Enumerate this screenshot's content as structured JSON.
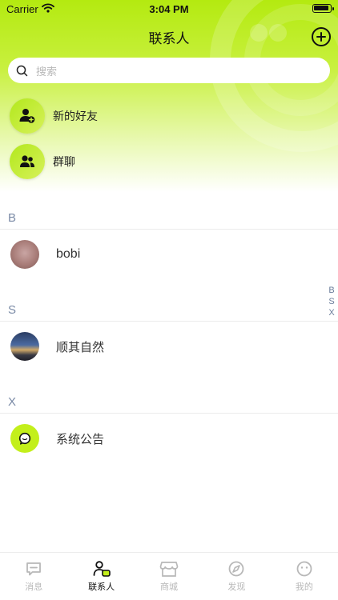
{
  "status_bar": {
    "carrier": "Carrier",
    "time": "3:04 PM"
  },
  "nav": {
    "title": "联系人",
    "add_icon": "plus-circle-icon"
  },
  "search": {
    "placeholder": "搜索"
  },
  "entries": [
    {
      "label": "新的好友",
      "icon": "add-friend-icon"
    },
    {
      "label": "群聊",
      "icon": "group-icon"
    }
  ],
  "sections": [
    {
      "letter": "B",
      "contacts": [
        {
          "name": "bobi",
          "avatar": "photo"
        }
      ]
    },
    {
      "letter": "S",
      "contacts": [
        {
          "name": "顺其自然",
          "avatar": "photo"
        }
      ]
    },
    {
      "letter": "X",
      "contacts": [
        {
          "name": "系统公告",
          "avatar": "chat-bubble-icon"
        }
      ]
    }
  ],
  "index_letters": [
    "B",
    "S",
    "X"
  ],
  "tabs": [
    {
      "label": "消息",
      "icon": "message-icon",
      "active": false
    },
    {
      "label": "联系人",
      "icon": "contacts-icon",
      "active": true
    },
    {
      "label": "商城",
      "icon": "store-icon",
      "active": false
    },
    {
      "label": "发现",
      "icon": "compass-icon",
      "active": false
    },
    {
      "label": "我的",
      "icon": "face-icon",
      "active": false
    }
  ],
  "colors": {
    "accent": "#b4ea10",
    "index_text": "#7a8aa6",
    "inactive_tab": "#b8b8b8"
  }
}
